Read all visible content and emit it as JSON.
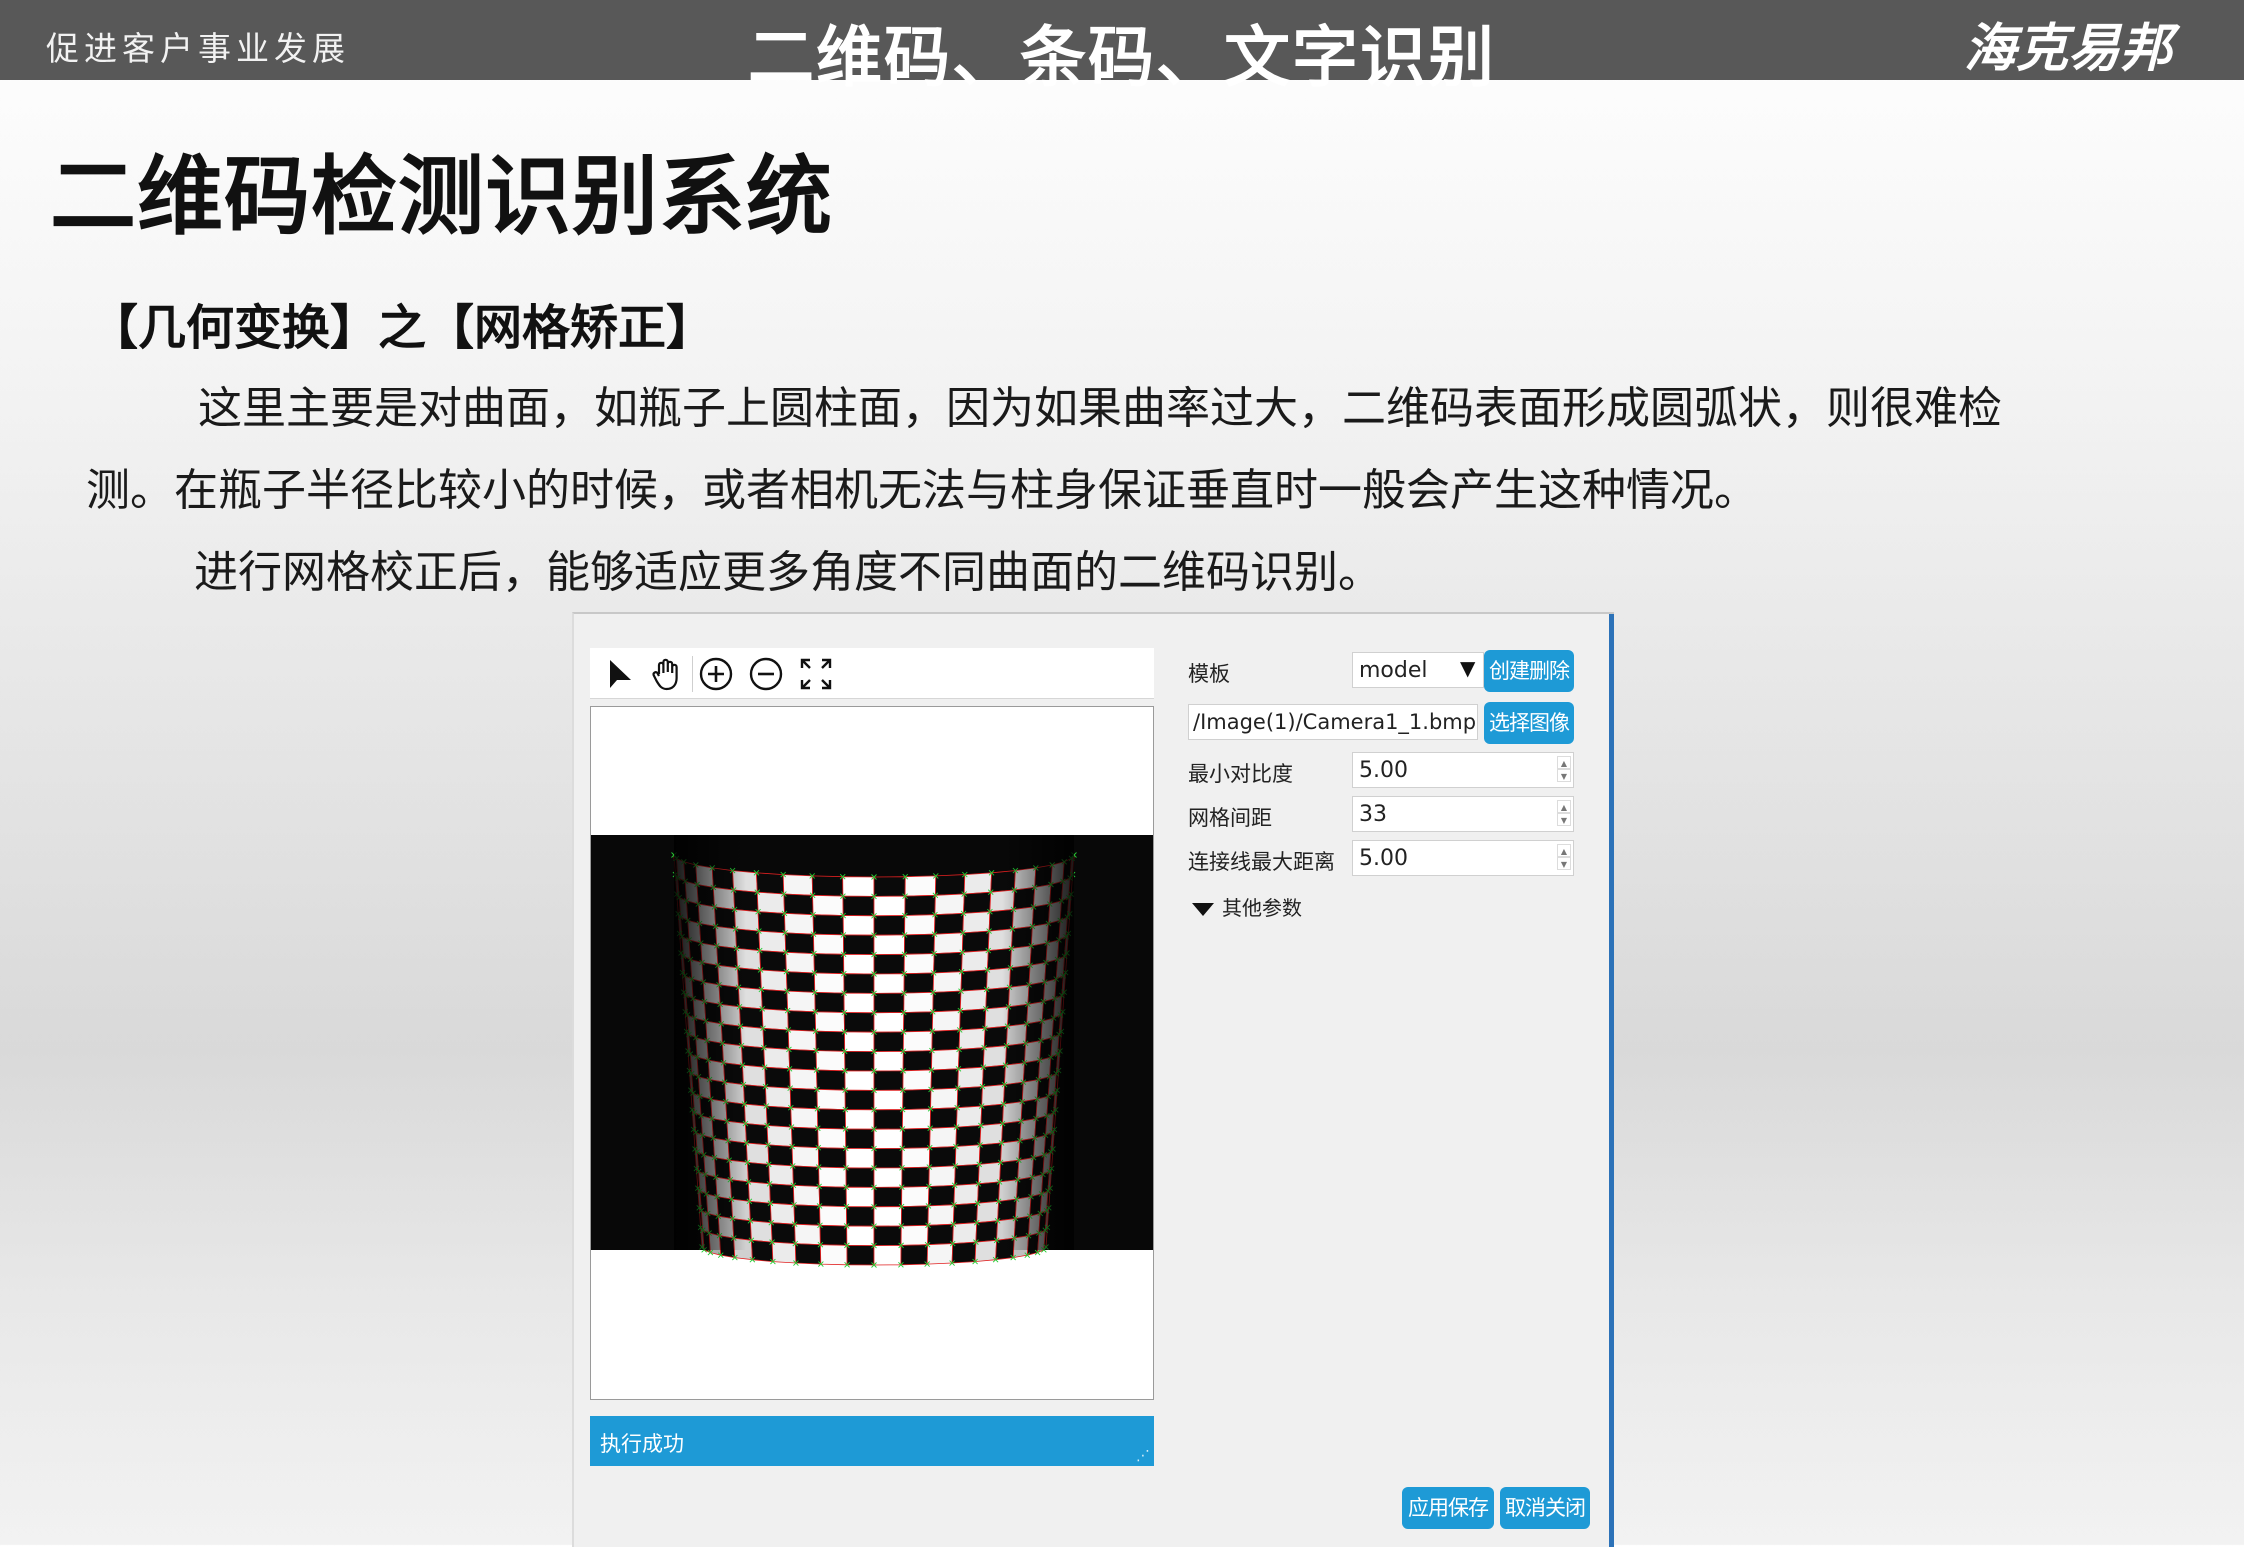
{
  "header": {
    "slogan": "促进客户事业发展",
    "center_title": "二维码、条码、文字识别",
    "brand": "海克易邦"
  },
  "page": {
    "title": "二维码检测识别系统",
    "section_title": "【几何变换】之【网格矫正】",
    "paragraph1_line1": "这里主要是对曲面，如瓶子上圆柱面，因为如果曲率过大，二维码表面形成圆弧状，则很难检",
    "paragraph1_line2": "测。在瓶子半径比较小的时候，或者相机无法与柱身保证垂直时一般会产生这种情况。",
    "paragraph2": "进行网格校正后，能够适应更多角度不同曲面的二维码识别。"
  },
  "app": {
    "toolbar_icons": [
      "pointer-icon",
      "hand-icon",
      "zoom-in-icon",
      "zoom-out-icon",
      "fit-screen-icon"
    ],
    "status": "执行成功",
    "form": {
      "template_label": "模板",
      "template_value": "model",
      "create_button": "创建",
      "delete_button": "删除",
      "image_path": "/Image(1)/Camera1_1.bmp",
      "select_image_button": "选择图像",
      "min_contrast_label": "最小对比度",
      "min_contrast_value": "5.00",
      "grid_spacing_label": "网格间距",
      "grid_spacing_value": "33",
      "max_link_distance_label": "连接线最大距离",
      "max_link_distance_value": "5.00",
      "other_params_label": "其他参数"
    },
    "apply_save_button": "应用保存",
    "cancel_close_button": "取消关闭",
    "colors": {
      "accent": "#1e9ad6",
      "grid_line": "#e02020",
      "grid_point": "#22cc33"
    }
  }
}
